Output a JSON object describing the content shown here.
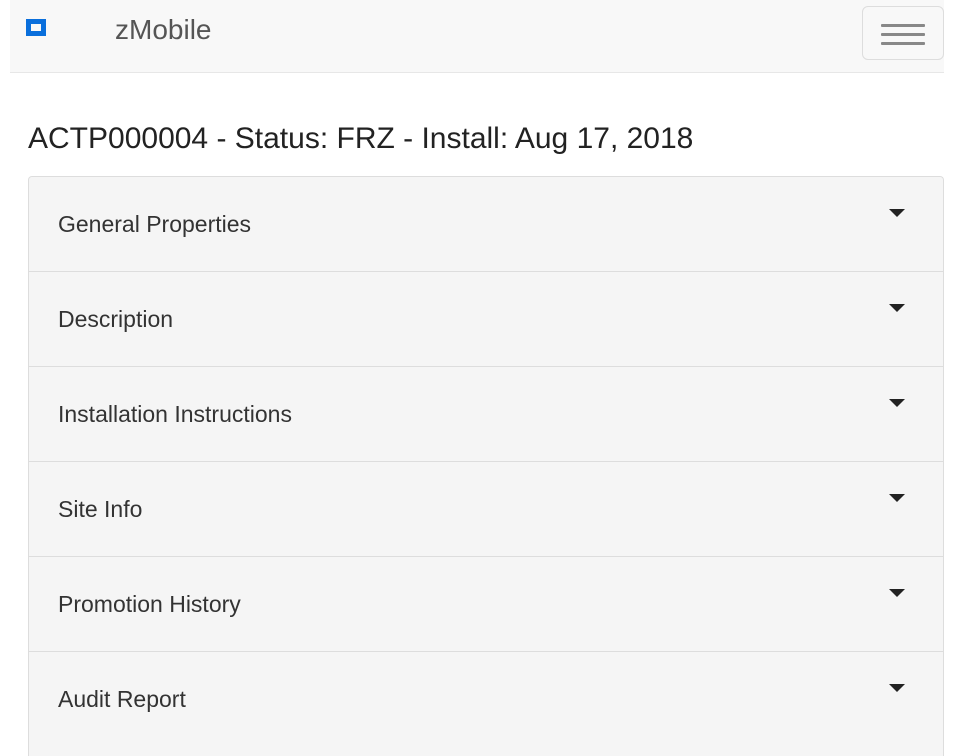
{
  "navbar": {
    "brand_name": "zMobile",
    "brand_icon": "square-logo-icon",
    "menu_icon": "hamburger-menu-icon"
  },
  "page": {
    "title": "ACTP000004 - Status: FRZ - Install: Aug 17, 2018"
  },
  "panels": [
    {
      "label": "General Properties",
      "icon": "caret-down-icon"
    },
    {
      "label": "Description",
      "icon": "caret-down-icon"
    },
    {
      "label": "Installation Instructions",
      "icon": "caret-down-icon"
    },
    {
      "label": "Site Info",
      "icon": "caret-down-icon"
    },
    {
      "label": "Promotion History",
      "icon": "caret-down-icon"
    },
    {
      "label": "Audit Report",
      "icon": "caret-down-icon"
    }
  ],
  "colors": {
    "brand_accent": "#0a6fdc",
    "navbar_bg": "#f8f8f8",
    "panel_bg": "#f5f5f5"
  }
}
